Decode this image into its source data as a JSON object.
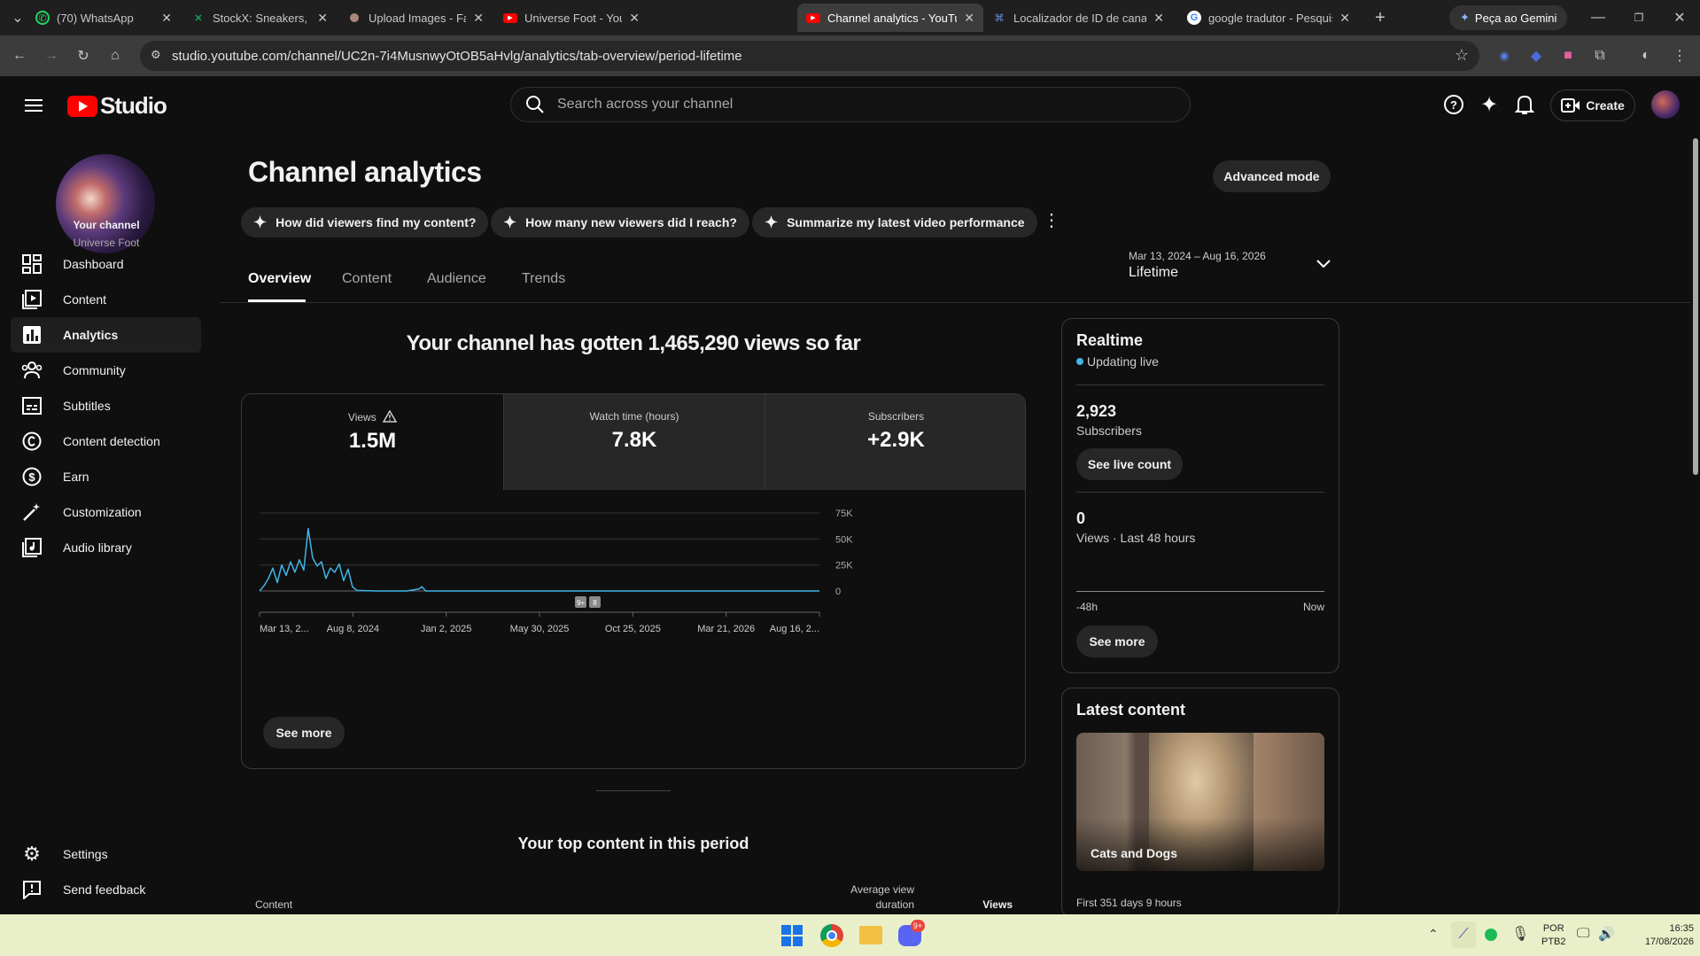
{
  "browser": {
    "tabs": [
      {
        "title": "(70) WhatsApp",
        "icon": "whatsapp-icon",
        "color": "#25d366"
      },
      {
        "title": "StockX: Sneakers, Streetwear",
        "icon": "stockx-icon",
        "color": "#0f7b3f"
      },
      {
        "title": "Upload Images - Fameswap",
        "icon": "fameswap-icon",
        "color": "#a87"
      },
      {
        "title": "Universe Foot - YouTube",
        "icon": "youtube-icon",
        "color": "#ff0000"
      },
      {
        "title": "Channel analytics - YouTube",
        "icon": "youtube-icon",
        "color": "#ff0000"
      },
      {
        "title": "Localizador de ID de canal",
        "icon": "link-icon",
        "color": "#4a7de0"
      },
      {
        "title": "google tradutor - Pesquisa",
        "icon": "google-icon",
        "color": "#4285f4"
      }
    ],
    "gemini_label": "Peça ao Gemini",
    "url": "studio.youtube.com/channel/UC2n-7i4MusnwyOtOB5aHvlg/analytics/tab-overview/period-lifetime"
  },
  "studio": {
    "logo_text": "Studio",
    "search_placeholder": "Search across your channel",
    "create_label": "Create"
  },
  "sidebar": {
    "channel_label": "Your channel",
    "channel_name": "Universe Foot",
    "items": [
      {
        "label": "Dashboard",
        "icon": "dashboard-icon"
      },
      {
        "label": "Content",
        "icon": "content-icon"
      },
      {
        "label": "Analytics",
        "icon": "analytics-icon"
      },
      {
        "label": "Community",
        "icon": "community-icon"
      },
      {
        "label": "Subtitles",
        "icon": "subtitles-icon"
      },
      {
        "label": "Content detection",
        "icon": "copyright-icon"
      },
      {
        "label": "Earn",
        "icon": "dollar-icon"
      },
      {
        "label": "Customization",
        "icon": "wand-icon"
      },
      {
        "label": "Audio library",
        "icon": "audio-library-icon"
      }
    ],
    "settings_label": "Settings",
    "feedback_label": "Send feedback"
  },
  "main": {
    "title": "Channel analytics",
    "advanced_mode": "Advanced mode",
    "suggestions": [
      "How did viewers find my content?",
      "How many new viewers did I reach?",
      "Summarize my latest video performance"
    ],
    "tabs": [
      "Overview",
      "Content",
      "Audience",
      "Trends"
    ],
    "period_range": "Mar 13, 2024 – Aug 16, 2026",
    "period_label": "Lifetime",
    "headline": "Your channel has gotten 1,465,290 views so far",
    "metrics": [
      {
        "label": "Views",
        "value": "1.5M"
      },
      {
        "label": "Watch time (hours)",
        "value": "7.8K"
      },
      {
        "label": "Subscribers",
        "value": "+2.9K"
      }
    ],
    "see_more": "See more",
    "top_content_title": "Your top content in this period",
    "col_content": "Content",
    "col_avd_1": "Average view",
    "col_avd_2": "duration",
    "col_views": "Views"
  },
  "chart_data": {
    "type": "line",
    "ylim": [
      0,
      75000
    ],
    "y_ticks": [
      "75K",
      "50K",
      "25K",
      "0"
    ],
    "x_tick_labels": [
      "Mar 13, 2...",
      "Aug 8, 2024",
      "Jan 2, 2025",
      "May 30, 2025",
      "Oct 25, 2025",
      "Mar 21, 2026",
      "Aug 16, 2..."
    ],
    "markers": [
      "9+",
      "8"
    ],
    "series": [
      {
        "color": "#41b4e6",
        "x": [
          "2024-03-13",
          "2024-03-20",
          "2024-03-27",
          "2024-04-03",
          "2024-04-10",
          "2024-04-17",
          "2024-04-24",
          "2024-05-01",
          "2024-05-08",
          "2024-05-15",
          "2024-05-22",
          "2024-05-29",
          "2024-06-05",
          "2024-06-12",
          "2024-06-19",
          "2024-06-26",
          "2024-07-03",
          "2024-07-10",
          "2024-07-17",
          "2024-07-24",
          "2024-07-31",
          "2024-08-07",
          "2024-08-14",
          "2024-09-15",
          "2024-11-01",
          "2024-11-20",
          "2024-11-25",
          "2024-12-01",
          "2025-03-01",
          "2025-08-01",
          "2026-01-01",
          "2026-08-16"
        ],
        "y": [
          0,
          5000,
          12000,
          22000,
          8000,
          25000,
          15000,
          28000,
          18000,
          30000,
          20000,
          60000,
          32000,
          24000,
          28000,
          12000,
          22000,
          18000,
          26000,
          10000,
          21000,
          4000,
          500,
          0,
          0,
          2000,
          4000,
          0,
          0,
          0,
          0,
          0
        ]
      }
    ]
  },
  "realtime": {
    "title": "Realtime",
    "status": "Updating live",
    "subs_value": "2,923",
    "subs_label": "Subscribers",
    "live_count_btn": "See live count",
    "views_value": "0",
    "views_label": "Views · Last 48 hours",
    "axis_start": "-48h",
    "axis_end": "Now",
    "see_more": "See more"
  },
  "latest": {
    "title": "Latest content",
    "video_title": "Cats and Dogs",
    "meta": "First 351 days 9 hours"
  },
  "taskbar": {
    "lang_top": "POR",
    "lang_bottom": "PTB2",
    "time": "16:35",
    "date": "17/08/2026",
    "discord_badge": "9+"
  }
}
